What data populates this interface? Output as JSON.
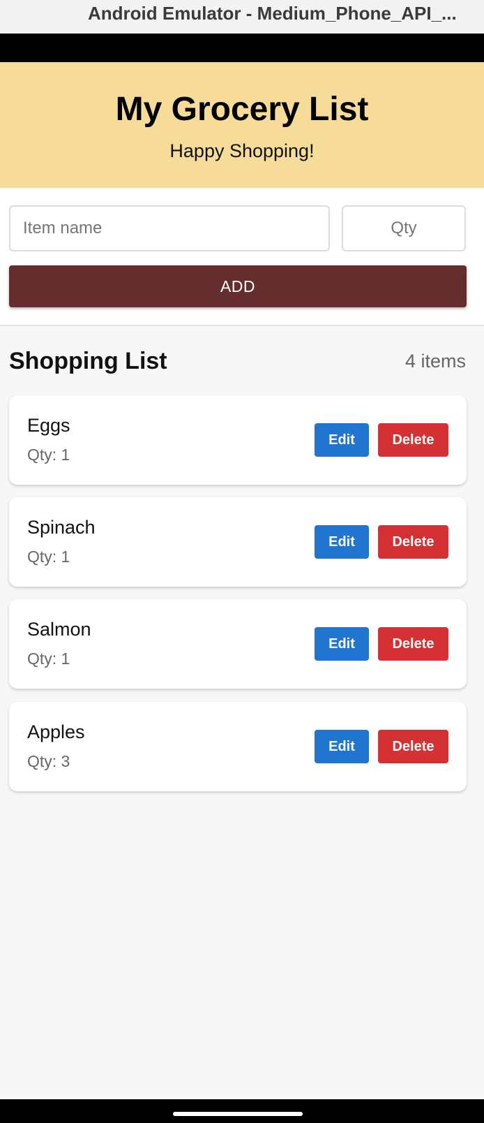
{
  "window": {
    "title": "Android Emulator - Medium_Phone_API_..."
  },
  "header": {
    "title": "My Grocery List",
    "subtitle": "Happy Shopping!"
  },
  "form": {
    "item_placeholder": "Item name",
    "qty_placeholder": "Qty",
    "add_label": "ADD"
  },
  "list": {
    "title": "Shopping List",
    "count": "4 items",
    "items": [
      {
        "name": "Eggs",
        "qty": "Qty: 1",
        "edit_label": "Edit",
        "delete_label": "Delete"
      },
      {
        "name": "Spinach",
        "qty": "Qty: 1",
        "edit_label": "Edit",
        "delete_label": "Delete"
      },
      {
        "name": "Salmon",
        "qty": "Qty: 1",
        "edit_label": "Edit",
        "delete_label": "Delete"
      },
      {
        "name": "Apples",
        "qty": "Qty: 3",
        "edit_label": "Edit",
        "delete_label": "Delete"
      }
    ]
  },
  "colors": {
    "header_bg": "#f6dc98",
    "add_button": "#642e2e",
    "edit_button": "#1f75d0",
    "delete_button": "#d33134"
  }
}
